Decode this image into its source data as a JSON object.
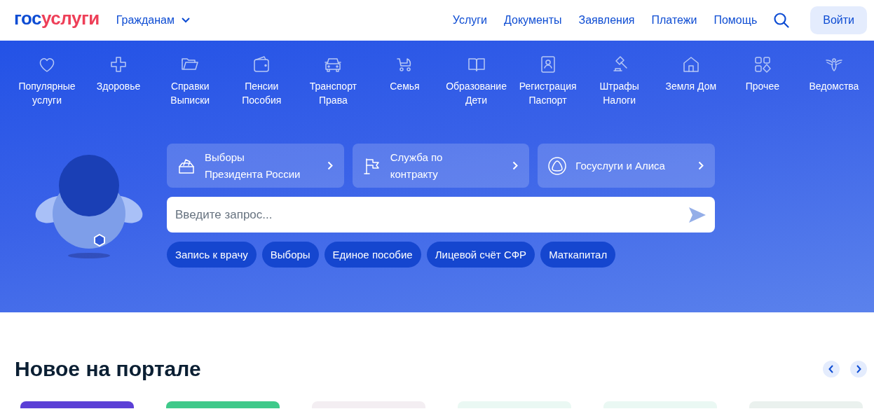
{
  "header": {
    "logo": {
      "part_1": "гос",
      "part_2": "услуги"
    },
    "audience": "Гражданам",
    "nav": [
      "Услуги",
      "Документы",
      "Заявления",
      "Платежи",
      "Помощь"
    ],
    "login": "Войти"
  },
  "categories": [
    "Популярные\nуслуги",
    "Здоровье",
    "Справки\nВыписки",
    "Пенсии\nПособия",
    "Транспорт\nПрава",
    "Семья",
    "Образование\nДети",
    "Регистрация\nПаспорт",
    "Штрафы\nНалоги",
    "Земля Дом",
    "Прочее",
    "Ведомства"
  ],
  "promos": [
    "Выборы\nПрезидента России",
    "Служба по\nконтракту",
    "Госуслуги и Алиса"
  ],
  "search": {
    "placeholder": "Введите запрос..."
  },
  "quick_links": [
    "Запись к врачу",
    "Выборы",
    "Единое пособие",
    "Лицевой счёт СФР",
    "Маткапитал"
  ],
  "news": {
    "title": "Новое на портале",
    "cards": [
      {
        "color": "#5b3fd6"
      },
      {
        "color": "#3fc98a"
      },
      {
        "color": "#f3eef2"
      },
      {
        "color": "#eaf8f3"
      },
      {
        "color": "#eaf8f3"
      },
      {
        "color": "#eaf1ee"
      }
    ]
  }
}
